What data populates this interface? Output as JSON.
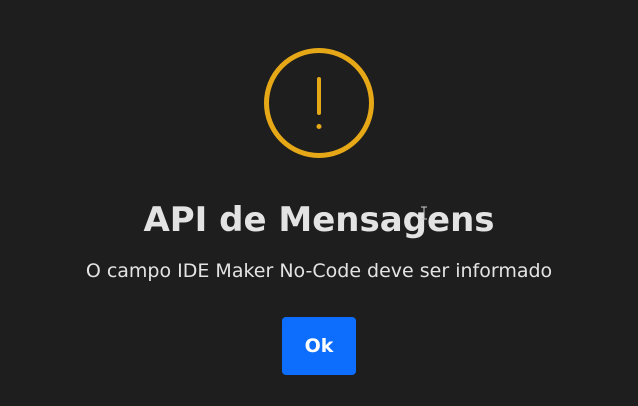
{
  "dialog": {
    "icon": "warning-exclamation-icon",
    "title": "API de Mensagens",
    "message": "O campo IDE Maker No-Code deve ser informado",
    "ok_label": "Ok"
  },
  "colors": {
    "background": "#1e1e1e",
    "warning": "#e6a817",
    "text": "#e3e3e3",
    "button": "#0d6efd",
    "button_text": "#ffffff"
  }
}
